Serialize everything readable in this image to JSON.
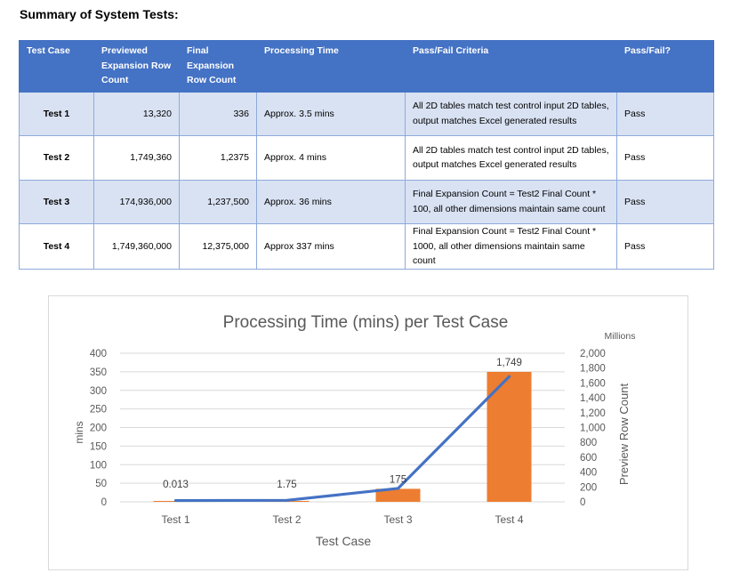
{
  "document": {
    "title": "Summary of System Tests:"
  },
  "table": {
    "headers": [
      "Test Case",
      "Previewed Expansion Row Count",
      "Final Expansion Row Count",
      "Processing Time",
      "Pass/Fail Criteria",
      "Pass/Fail?"
    ],
    "rows": [
      [
        "Test 1",
        "13,320",
        "336",
        "Approx. 3.5 mins",
        "All 2D tables match test control input 2D tables, output matches Excel generated results",
        "Pass"
      ],
      [
        "Test 2",
        "1,749,360",
        "1,2375",
        "Approx. 4 mins",
        "All 2D tables match test control input 2D tables, output matches Excel generated results",
        "Pass"
      ],
      [
        "Test 3",
        "174,936,000",
        "1,237,500",
        "Approx. 36 mins",
        "Final Expansion Count = Test2 Final Count * 100, all other dimensions maintain same count",
        "Pass"
      ],
      [
        "Test 4",
        "1,749,360,000",
        "12,375,000",
        "Approx 337 mins",
        "Final Expansion Count = Test2 Final Count * 1000, all other dimensions maintain same count",
        "Pass"
      ]
    ]
  },
  "colors": {
    "header_bg": "#4472c4",
    "band_bg": "#d9e2f3",
    "border": "#8eaadb",
    "bar": "#ed7d31",
    "line": "#4472c4"
  },
  "chart_data": {
    "type": "bar",
    "title": "Processing Time (mins) per Test Case",
    "xlabel": "Test Case",
    "ylabel": "mins",
    "y2label": "Preview Row Count",
    "y2unit": "Millions",
    "categories": [
      "Test 1",
      "Test 2",
      "Test 3",
      "Test 4"
    ],
    "ylim": [
      0,
      400
    ],
    "yticks": [
      0,
      50,
      100,
      150,
      200,
      250,
      300,
      350,
      400
    ],
    "y2lim": [
      0,
      2000
    ],
    "y2ticks": [
      "0",
      "200",
      "400",
      "600",
      "800",
      "1,000",
      "1,200",
      "1,400",
      "1,600",
      "1,800",
      "2,000"
    ],
    "grid": true,
    "series": [
      {
        "type": "bar",
        "axis": "right",
        "values": [
          0.013,
          1.75,
          175,
          1749
        ],
        "labels": [
          "0.013",
          "1.75",
          "175",
          "1,749"
        ]
      },
      {
        "type": "line",
        "axis": "left",
        "values": [
          3.5,
          4,
          36,
          337
        ]
      }
    ]
  }
}
